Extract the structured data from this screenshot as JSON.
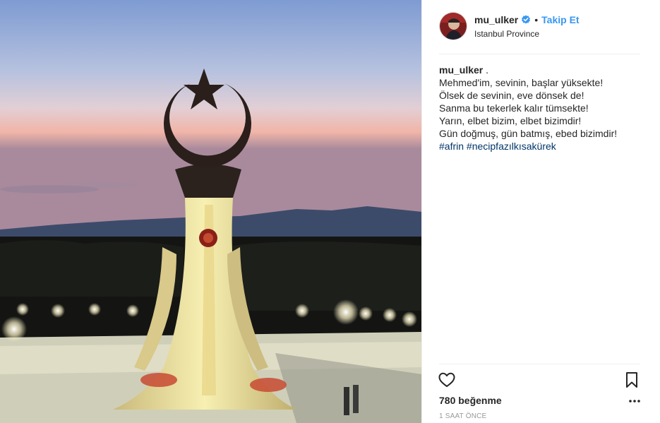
{
  "post": {
    "image_alt": "Crescent and star monument at dusk",
    "author": {
      "username": "mu_ulker",
      "verified": true,
      "follow_label": "Takip Et",
      "dot": "•",
      "location": "Istanbul Province"
    },
    "caption": {
      "username": "mu_ulker",
      "suffix": " .",
      "lines": [
        "Mehmed'im, sevinin, başlar yüksekte!",
        "Ölsek de sevinin, eve dönsek de!",
        "Sanma bu tekerlek kalır tümsekte!",
        "Yarın, elbet bizim, elbet bizimdir!",
        "Gün doğmuş, gün batmış, ebed bizimdir!"
      ],
      "hashtags": [
        "#afrin",
        "#necipfazılkısakürek"
      ]
    },
    "likes_label": "780 beğenme",
    "timestamp": "1 SAAT ÖNCE",
    "icons": {
      "like": "heart-outline-icon",
      "save": "bookmark-icon",
      "more": "more-dots-icon",
      "verified": "verified-badge-icon"
    },
    "colors": {
      "link_blue": "#3897f0",
      "hashtag": "#003569",
      "verified": "#3897f0",
      "muted": "#999999"
    }
  }
}
